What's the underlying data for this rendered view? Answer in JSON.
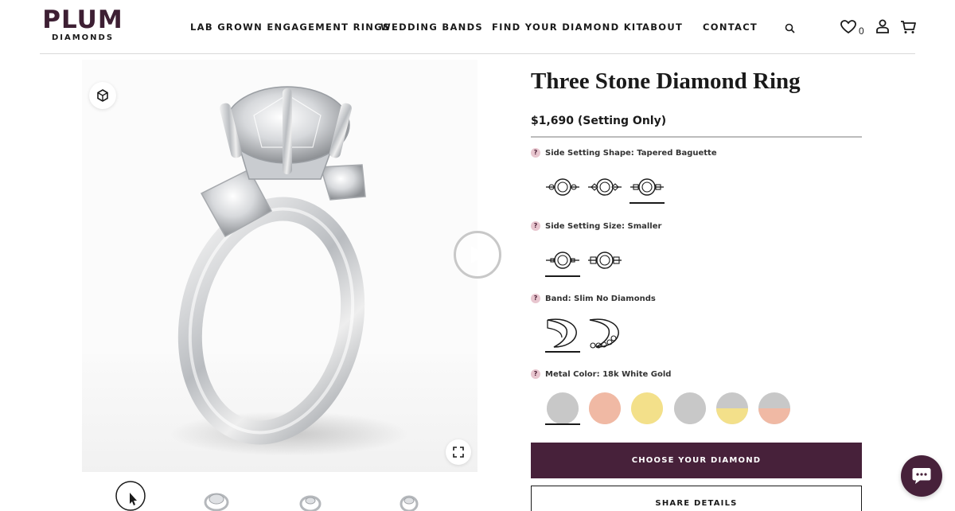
{
  "brand": {
    "name": "PLUM",
    "sub": "DIAMONDS",
    "color": "#3d1f33"
  },
  "nav": [
    {
      "label": "LAB GROWN ENGAGEMENT RINGS"
    },
    {
      "label": "WEDDING BANDS"
    },
    {
      "label": "FIND YOUR DIAMOND KIT"
    },
    {
      "label": "ABOUT"
    },
    {
      "label": "CONTACT"
    }
  ],
  "header_icons": [
    "search-icon",
    "heart-icon",
    "account-icon",
    "cart-icon"
  ],
  "wishlist_count": "0",
  "product": {
    "title": "Three Stone Diamond Ring",
    "price": "$1,690 (Setting Only)"
  },
  "options": {
    "side_shape": {
      "label": "Side Setting Shape: Tapered Baguette",
      "count": 3,
      "selected_index": 2
    },
    "side_size": {
      "label": "Side Setting Size: Smaller",
      "count": 2,
      "selected_index": 0
    },
    "band": {
      "label": "Band: Slim No Diamonds",
      "count": 2,
      "selected_index": 0
    },
    "metal": {
      "label": "Metal Color: 18k White Gold",
      "selected_index": 0,
      "swatches": [
        {
          "name": "white-gold",
          "top": "#c8c8c8",
          "bottom": "#c8c8c8"
        },
        {
          "name": "rose-gold",
          "top": "#f0b9a4",
          "bottom": "#f0b9a4"
        },
        {
          "name": "yellow-gold",
          "top": "#f3e08a",
          "bottom": "#f3e08a"
        },
        {
          "name": "platinum",
          "top": "#c8c8c8",
          "bottom": "#c8c8c8"
        },
        {
          "name": "two-tone-yellow",
          "top": "#c8c8c8",
          "bottom": "#f3e08a"
        },
        {
          "name": "two-tone-rose",
          "top": "#c8c8c8",
          "bottom": "#f0b9a4"
        }
      ]
    }
  },
  "actions": {
    "primary": "CHOOSE YOUR DIAMOND",
    "secondary": "SHARE DETAILS"
  },
  "colors": {
    "accent": "#47213a",
    "help_bg": "#e8c6cf"
  },
  "help_glyph": "?"
}
